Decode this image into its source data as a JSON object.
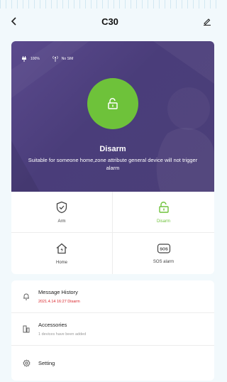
{
  "header": {
    "title": "C30"
  },
  "hero": {
    "battery_text": "100%",
    "signal_text": "No SIM",
    "mode": "Disarm",
    "description": "Suitable for someone home,zone attribute general device will not trigger alarm",
    "accent_color": "#6ec23a"
  },
  "modes": [
    {
      "label": "Arm",
      "icon": "shield-check-icon"
    },
    {
      "label": "Disarm",
      "icon": "unlock-icon"
    },
    {
      "label": "Home",
      "icon": "house-bolt-icon"
    },
    {
      "label": "SOS alarm",
      "icon": "sos-icon"
    }
  ],
  "menu": [
    {
      "title": "Message History",
      "subtitle": "2021.4.14 16:27 Disarm",
      "icon": "bell-icon"
    },
    {
      "title": "Accessories",
      "subtitle": "1 devices have been added",
      "icon": "accessories-icon"
    },
    {
      "title": "Setting",
      "icon": "gear-icon"
    }
  ]
}
